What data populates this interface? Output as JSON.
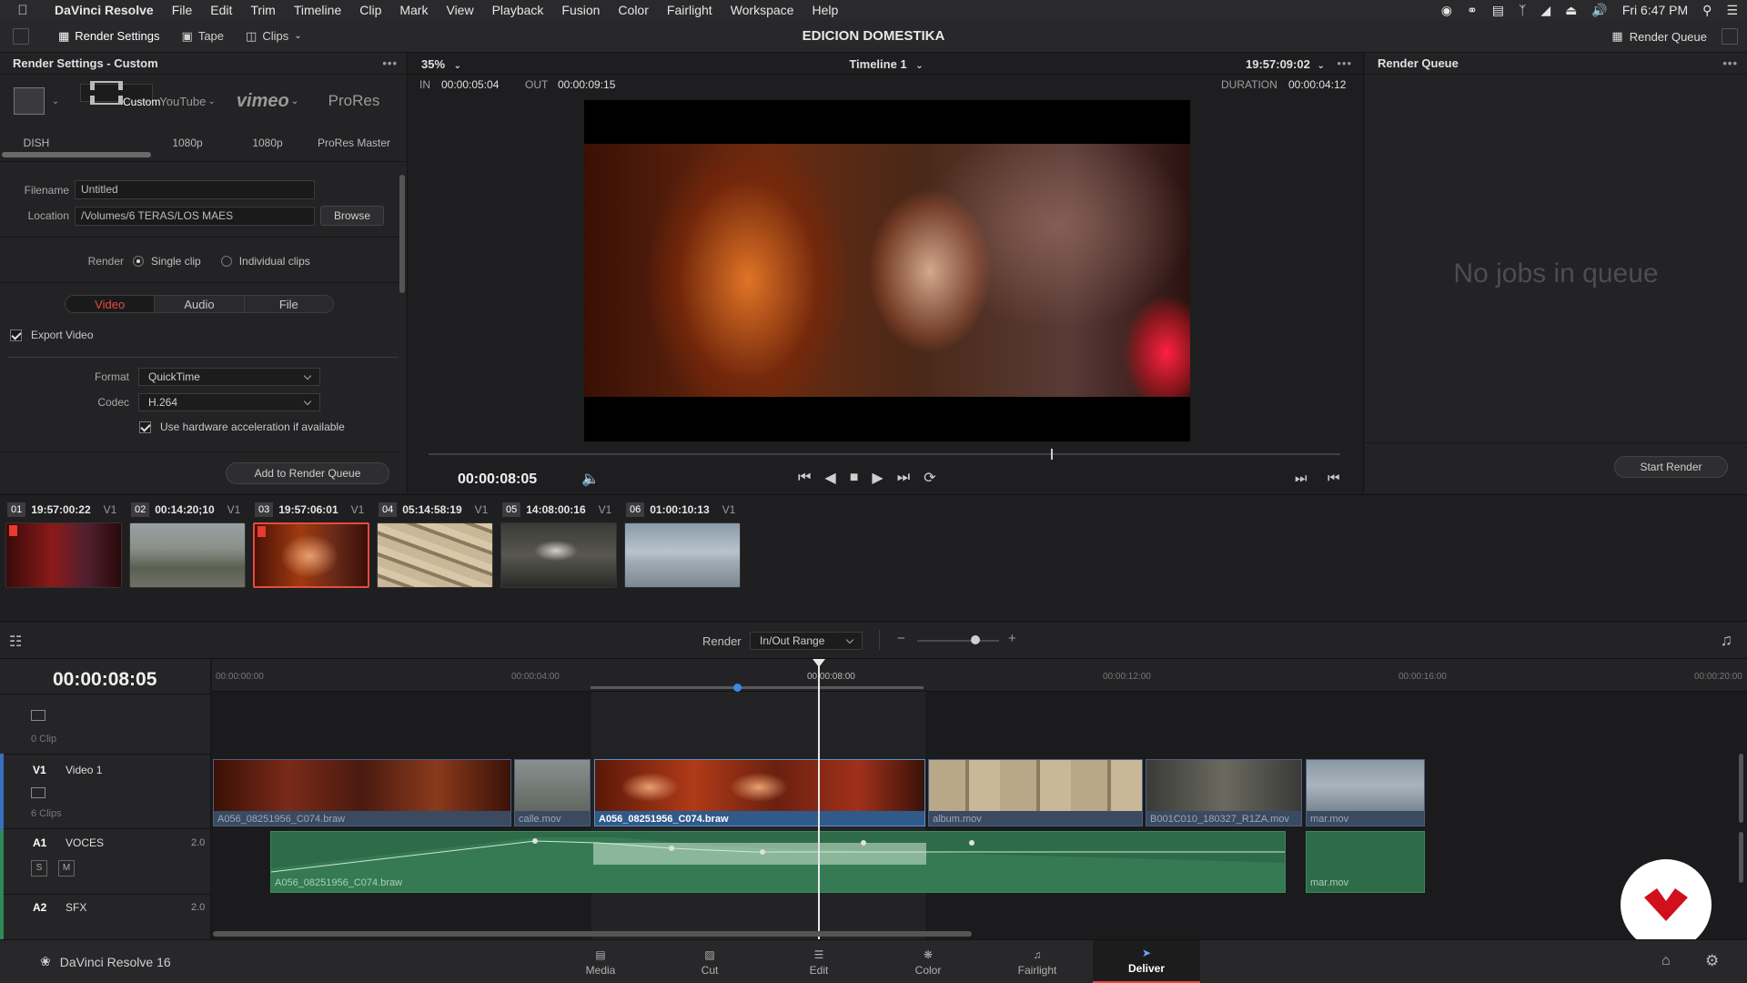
{
  "menubar": {
    "app": "DaVinci Resolve",
    "items": [
      "File",
      "Edit",
      "Trim",
      "Timeline",
      "Clip",
      "Mark",
      "View",
      "Playback",
      "Fusion",
      "Color",
      "Fairlight",
      "Workspace",
      "Help"
    ],
    "clock": "Fri 6:47 PM"
  },
  "toolbar": {
    "render_settings": "Render Settings",
    "tape": "Tape",
    "clips": "Clips",
    "project_title": "EDICION DOMESTIKA",
    "render_queue": "Render Queue"
  },
  "render_settings": {
    "title": "Render Settings - Custom",
    "presets": [
      {
        "label": "DISH",
        "icon": "dish-icon"
      },
      {
        "label": "Custom",
        "icon": "film-icon"
      },
      {
        "label": "1080p",
        "brand": "YouTube"
      },
      {
        "label": "1080p",
        "brand": "vimeo"
      },
      {
        "label": "ProRes Master",
        "brand": "ProRes"
      }
    ],
    "filename_label": "Filename",
    "filename_value": "Untitled",
    "location_label": "Location",
    "location_value": "/Volumes/6 TERAS/LOS MAES",
    "browse": "Browse",
    "render_label": "Render",
    "single_clip": "Single clip",
    "individual_clips": "Individual clips",
    "tabs": [
      "Video",
      "Audio",
      "File"
    ],
    "export_video": "Export Video",
    "format_label": "Format",
    "format_value": "QuickTime",
    "codec_label": "Codec",
    "codec_value": "H.264",
    "hw_accel": "Use hardware acceleration if available",
    "add_to_queue": "Add to Render Queue"
  },
  "viewer": {
    "zoom": "35%",
    "timeline_name": "Timeline 1",
    "timecode_top": "19:57:09:02",
    "in_label": "IN",
    "in_value": "00:00:05:04",
    "out_label": "OUT",
    "out_value": "00:00:09:15",
    "duration_label": "DURATION",
    "duration_value": "00:00:04:12",
    "current_tc": "00:00:08:05"
  },
  "render_queue": {
    "title": "Render Queue",
    "empty_text": "No jobs in queue",
    "start_render": "Start Render"
  },
  "clips_strip": [
    {
      "num": "01",
      "tc": "19:57:00:22",
      "track": "V1"
    },
    {
      "num": "02",
      "tc": "00:14:20;10",
      "track": "V1"
    },
    {
      "num": "03",
      "tc": "19:57:06:01",
      "track": "V1"
    },
    {
      "num": "04",
      "tc": "05:14:58:19",
      "track": "V1"
    },
    {
      "num": "05",
      "tc": "14:08:00:16",
      "track": "V1"
    },
    {
      "num": "06",
      "tc": "01:00:10:13",
      "track": "V1"
    }
  ],
  "timeline": {
    "render_label": "Render",
    "render_range": "In/Out Range",
    "current_tc": "00:00:08:05",
    "ruler": [
      "00:00:00:00",
      "00:00:04:00",
      "00:00:08:00",
      "00:00:12:00",
      "00:00:16:00",
      "00:00:20:00"
    ],
    "empty_track_count": "0 Clip",
    "v1_id": "V1",
    "v1_name": "Video 1",
    "v1_count": "6 Clips",
    "a1_id": "A1",
    "a1_name": "VOCES",
    "a1_level": "2.0",
    "a2_id": "A2",
    "a2_name": "SFX",
    "a2_level": "2.0",
    "solo": "S",
    "mute": "M",
    "video_clips": [
      "A056_08251956_C074.braw",
      "calle.mov",
      "A056_08251956_C074.braw",
      "album.mov",
      "B001C010_180327_R1ZA.mov",
      "mar.mov"
    ],
    "audio_clips": [
      "A056_08251956_C074.braw",
      "mar.mov"
    ]
  },
  "pages": [
    "Media",
    "Cut",
    "Edit",
    "Color",
    "Fairlight",
    "Deliver"
  ],
  "footer_app": "DaVinci Resolve 16"
}
